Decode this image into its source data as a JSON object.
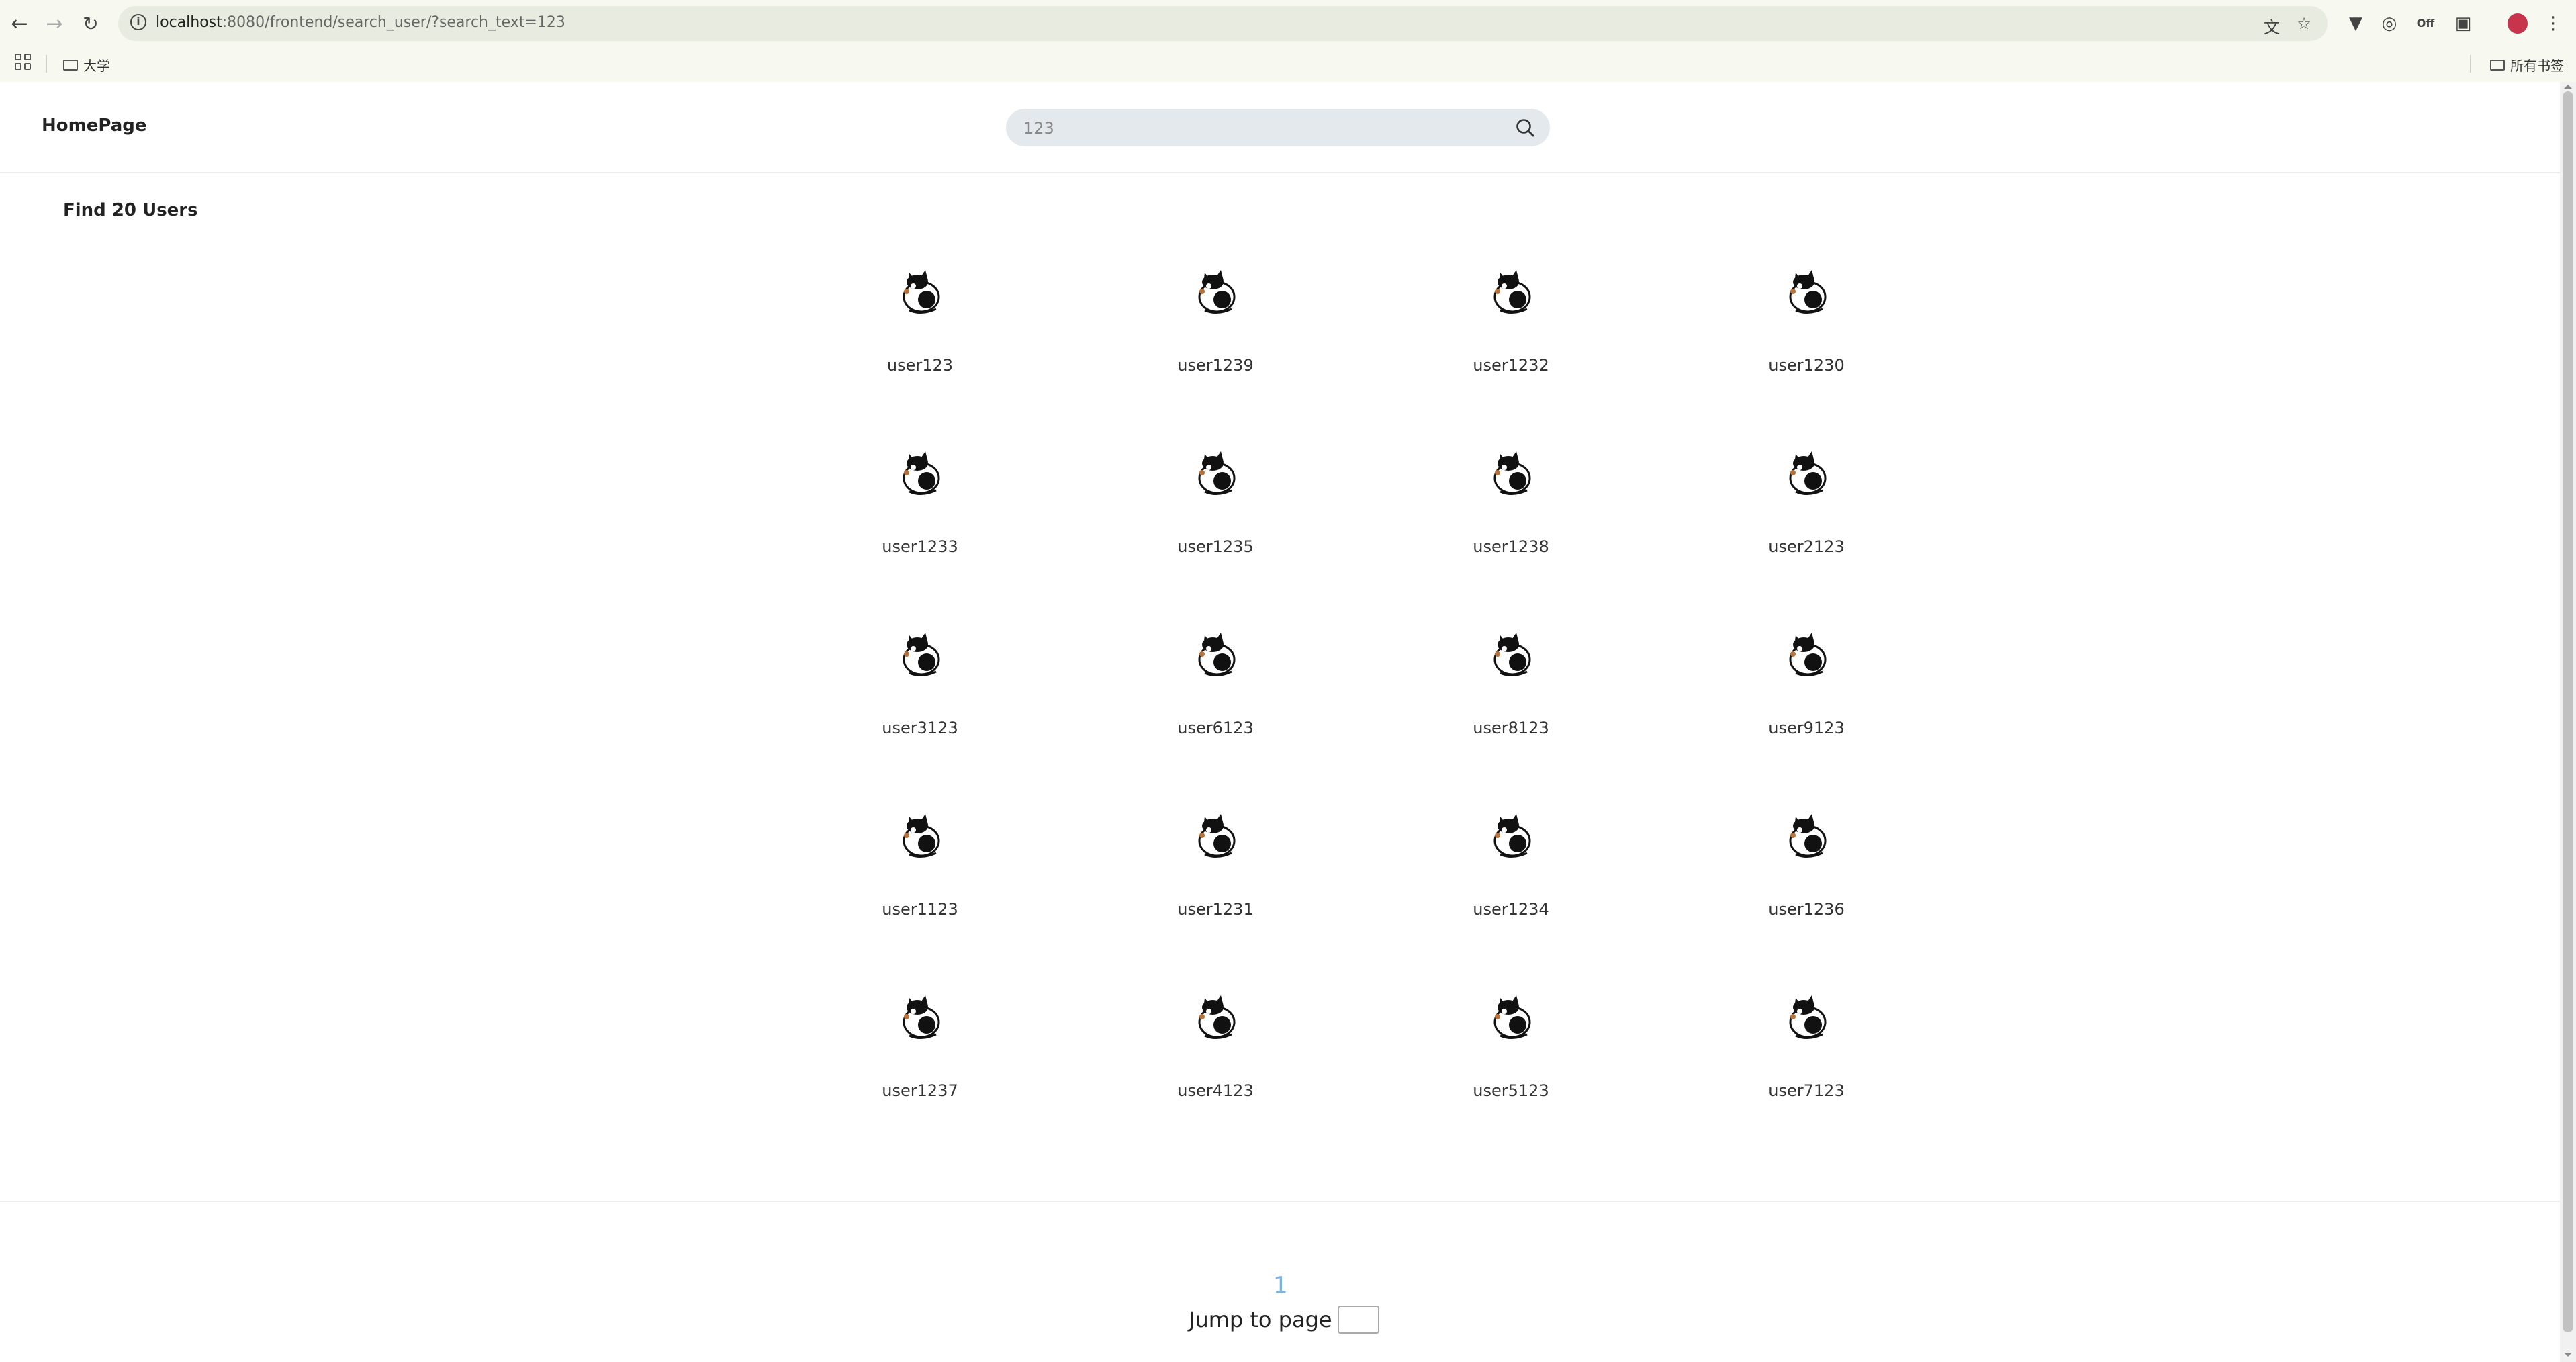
{
  "browser": {
    "url_host": "localhost",
    "url_rest": ":8080/frontend/search_user/?search_text=123",
    "bookmarks": [
      {
        "label": "大学"
      }
    ],
    "all_bookmarks_label": "所有书签"
  },
  "header": {
    "home_label": "HomePage",
    "search": {
      "value": "123",
      "placeholder": "123"
    }
  },
  "results": {
    "title": "Find 20 Users",
    "users": [
      "user123",
      "user1239",
      "user1232",
      "user1230",
      "user1233",
      "user1235",
      "user1238",
      "user2123",
      "user3123",
      "user6123",
      "user8123",
      "user9123",
      "user1123",
      "user1231",
      "user1234",
      "user1236",
      "user1237",
      "user4123",
      "user5123",
      "user7123"
    ]
  },
  "pagination": {
    "current_page": "1",
    "jump_label": "Jump to page"
  },
  "colors": {
    "page_link": "#7fb2e0",
    "search_bg": "#e3e9ed",
    "avatar_dot": "#c8344b"
  },
  "icons": [
    "back-icon",
    "forward-icon",
    "reload-icon",
    "site-info-icon",
    "translate-icon",
    "star-icon",
    "extension-icon",
    "menu-icon",
    "folder-icon",
    "search-icon",
    "cat-avatar-icon"
  ]
}
